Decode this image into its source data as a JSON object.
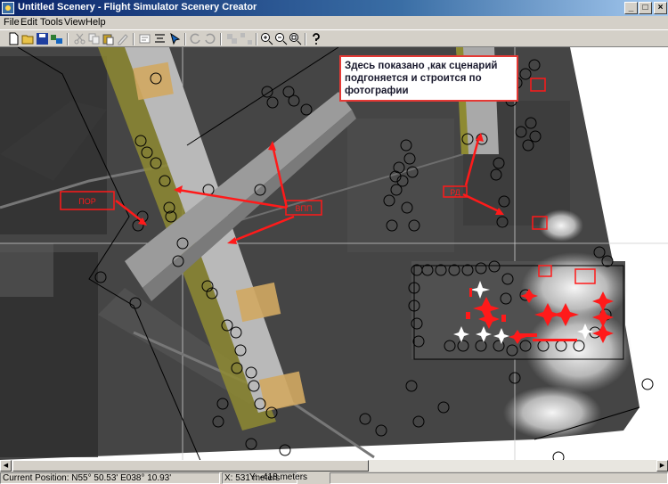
{
  "window": {
    "title": "Untitled Scenery - Flight Simulator Scenery Creator"
  },
  "menu": [
    "File",
    "Edit",
    "Tools",
    "View",
    "Help"
  ],
  "toolbar_icons": [
    "new-icon",
    "open-icon",
    "save-icon",
    "compile-icon",
    "cut-icon",
    "copy-icon",
    "paste-icon",
    "delete-icon",
    "properties-icon",
    "align-icon",
    "select-icon",
    "rotate-left-icon",
    "rotate-right-icon",
    "group-icon",
    "ungroup-icon",
    "zoom-in-icon",
    "zoom-out-icon",
    "zoom-fit-icon",
    "help-icon"
  ],
  "annotation": {
    "text": "Здесь показано ,как  сценарий подгоняется и строится по фотографии"
  },
  "map_labels": {
    "label1": "ПОР",
    "label2": "ВПП",
    "label3": "РД"
  },
  "status": {
    "position": "Current Position: N55° 50.53'  E038° 10.93'",
    "x": "X: 531 meters",
    "y": "Y: -418 meters"
  },
  "colors": {
    "marker": "#ff1a1a",
    "titlebar": "#0a246a"
  }
}
